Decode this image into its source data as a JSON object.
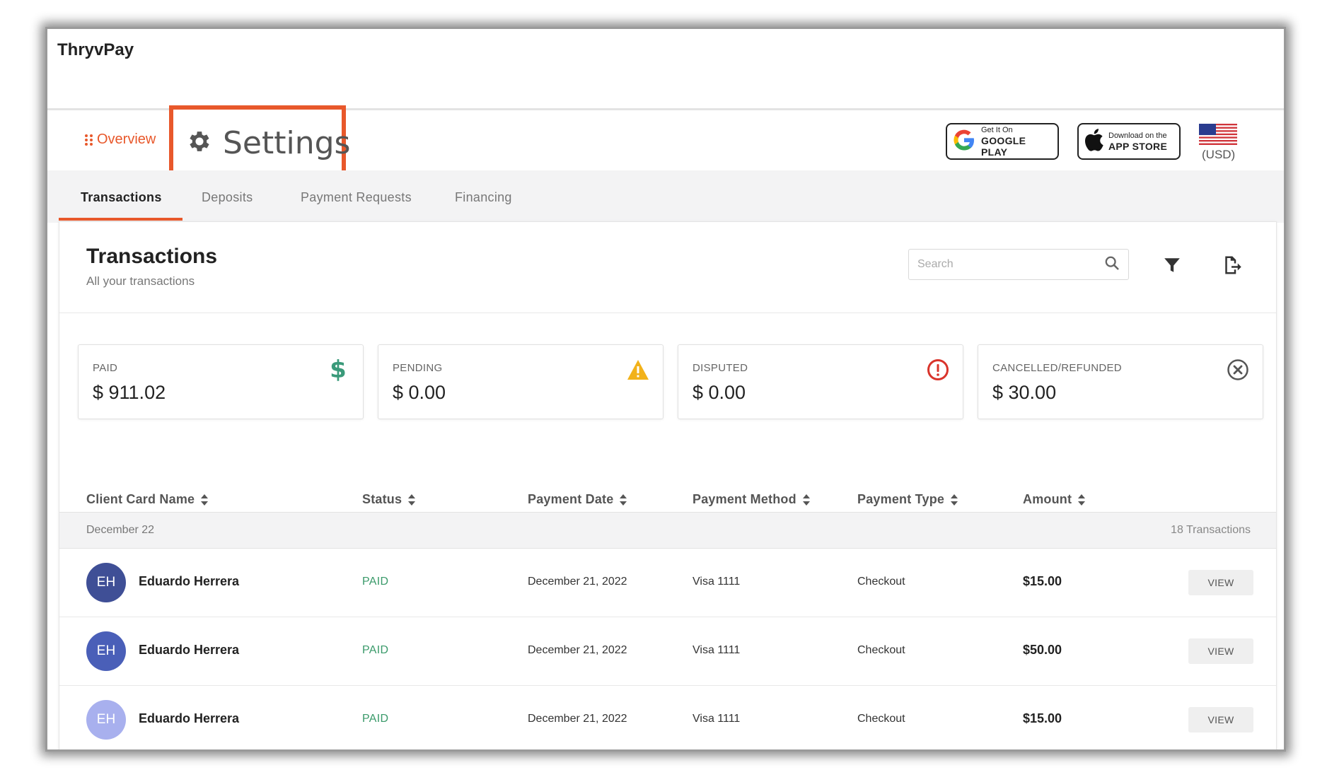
{
  "app": {
    "title": "ThryvPay"
  },
  "header": {
    "overview_label": "Overview",
    "settings_label": "Settings",
    "google_play": {
      "small": "Get It On",
      "big": "GOOGLE PLAY"
    },
    "app_store": {
      "small": "Download on the",
      "big": "APP STORE"
    },
    "currency": "(USD)"
  },
  "tabs": [
    {
      "label": "Transactions",
      "active": true
    },
    {
      "label": "Deposits",
      "active": false
    },
    {
      "label": "Payment Requests",
      "active": false
    },
    {
      "label": "Financing",
      "active": false
    }
  ],
  "panel": {
    "title": "Transactions",
    "subtitle": "All your transactions",
    "search_placeholder": "Search"
  },
  "stats": [
    {
      "label": "PAID",
      "value": "$ 911.02",
      "icon": "dollar-icon",
      "color": "#3a9a7a"
    },
    {
      "label": "PENDING",
      "value": "$ 0.00",
      "icon": "warning-icon",
      "color": "#f2b21a"
    },
    {
      "label": "DISPUTED",
      "value": "$ 0.00",
      "icon": "alert-circle-icon",
      "color": "#d9342b"
    },
    {
      "label": "CANCELLED/REFUNDED",
      "value": "$ 30.00",
      "icon": "close-circle-icon",
      "color": "#555555"
    }
  ],
  "columns": [
    "Client Card Name",
    "Status",
    "Payment Date",
    "Payment Method",
    "Payment Type",
    "Amount"
  ],
  "group": {
    "date": "December 22",
    "count": "18 Transactions"
  },
  "rows": [
    {
      "initials": "EH",
      "name": "Eduardo Herrera",
      "status": "PAID",
      "date": "December 21, 2022",
      "method": "Visa 1111",
      "type": "Checkout",
      "amount": "$15.00",
      "action": "VIEW",
      "avatar_color": "#3f4f96"
    },
    {
      "initials": "EH",
      "name": "Eduardo Herrera",
      "status": "PAID",
      "date": "December 21, 2022",
      "method": "Visa 1111",
      "type": "Checkout",
      "amount": "$50.00",
      "action": "VIEW",
      "avatar_color": "#4a5fb8"
    },
    {
      "initials": "EH",
      "name": "Eduardo Herrera",
      "status": "PAID",
      "date": "December 21, 2022",
      "method": "Visa 1111",
      "type": "Checkout",
      "amount": "$15.00",
      "action": "VIEW",
      "avatar_color": "#a8b0ee"
    }
  ],
  "colors": {
    "accent": "#e8582b",
    "paid_status": "#3a9a6a"
  }
}
